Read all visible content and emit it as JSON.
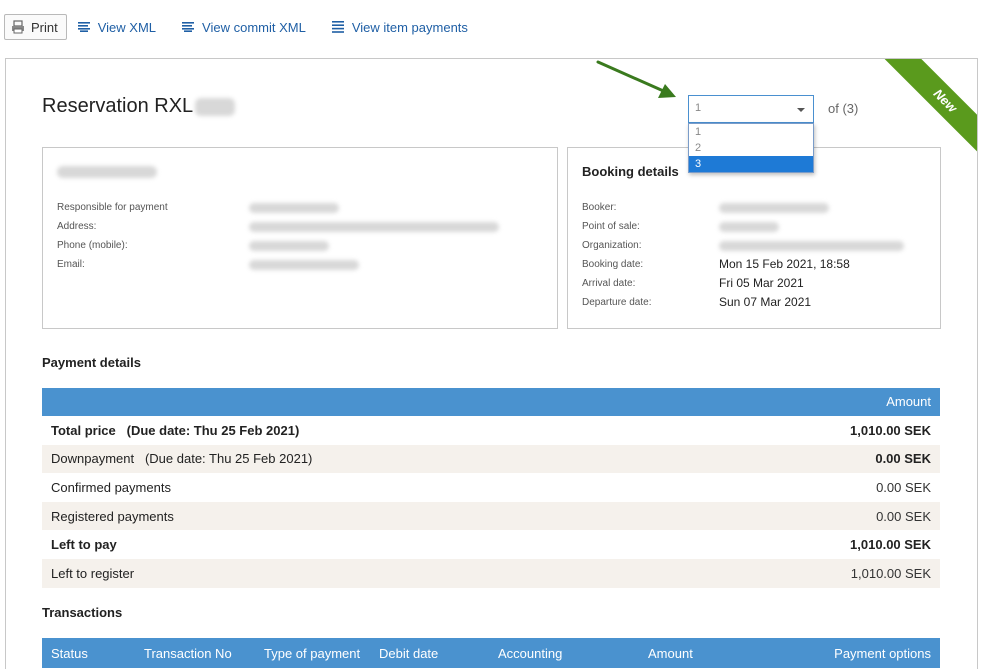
{
  "toolbar": {
    "print_label": "Print",
    "view_xml_label": "View XML",
    "view_commit_xml_label": "View commit XML",
    "view_item_payments_label": "View item payments"
  },
  "reservation": {
    "title_prefix": "Reservation RXL",
    "badge": "New"
  },
  "selector": {
    "value": "1",
    "of_text": "of (3)",
    "options": [
      "1",
      "2",
      "3"
    ],
    "highlighted_option": "3"
  },
  "customer": {
    "labels": {
      "responsible": "Responsible for payment",
      "address": "Address:",
      "phone": "Phone (mobile):",
      "email": "Email:"
    }
  },
  "booking": {
    "title": "Booking details",
    "labels": {
      "booker": "Booker:",
      "point_of_sale": "Point of sale:",
      "organization": "Organization:",
      "booking_date": "Booking date:",
      "arrival_date": "Arrival date:",
      "departure_date": "Departure date:"
    },
    "values": {
      "booking_date": "Mon 15 Feb 2021, 18:58",
      "arrival_date": "Fri 05 Mar 2021",
      "departure_date": "Sun 07 Mar 2021"
    }
  },
  "payment_details": {
    "title": "Payment details",
    "amount_header": "Amount",
    "rows": [
      {
        "label": "Total price",
        "note": "(Due date: Thu 25 Feb 2021)",
        "amount": "1,010.00 SEK"
      },
      {
        "label": "Downpayment",
        "note": "(Due date: Thu 25 Feb 2021)",
        "amount": "0.00 SEK"
      },
      {
        "label": "Confirmed payments",
        "note": "",
        "amount": "0.00 SEK"
      },
      {
        "label": "Registered payments",
        "note": "",
        "amount": "0.00 SEK"
      },
      {
        "label": "Left to pay",
        "note": "",
        "amount": "1,010.00 SEK"
      },
      {
        "label": "Left to register",
        "note": "",
        "amount": "1,010.00 SEK"
      }
    ]
  },
  "transactions": {
    "title": "Transactions",
    "columns": [
      "Status",
      "Transaction No",
      "Type of payment",
      "Debit date",
      "Accounting",
      "Amount",
      "Payment options"
    ]
  },
  "colors": {
    "header_blue": "#4a92cf",
    "link_blue": "#1f5fa5",
    "ribbon_green": "#5a9a1d",
    "row_alt": "#f5f1ec",
    "arrow_green": "#3a7a1e"
  }
}
